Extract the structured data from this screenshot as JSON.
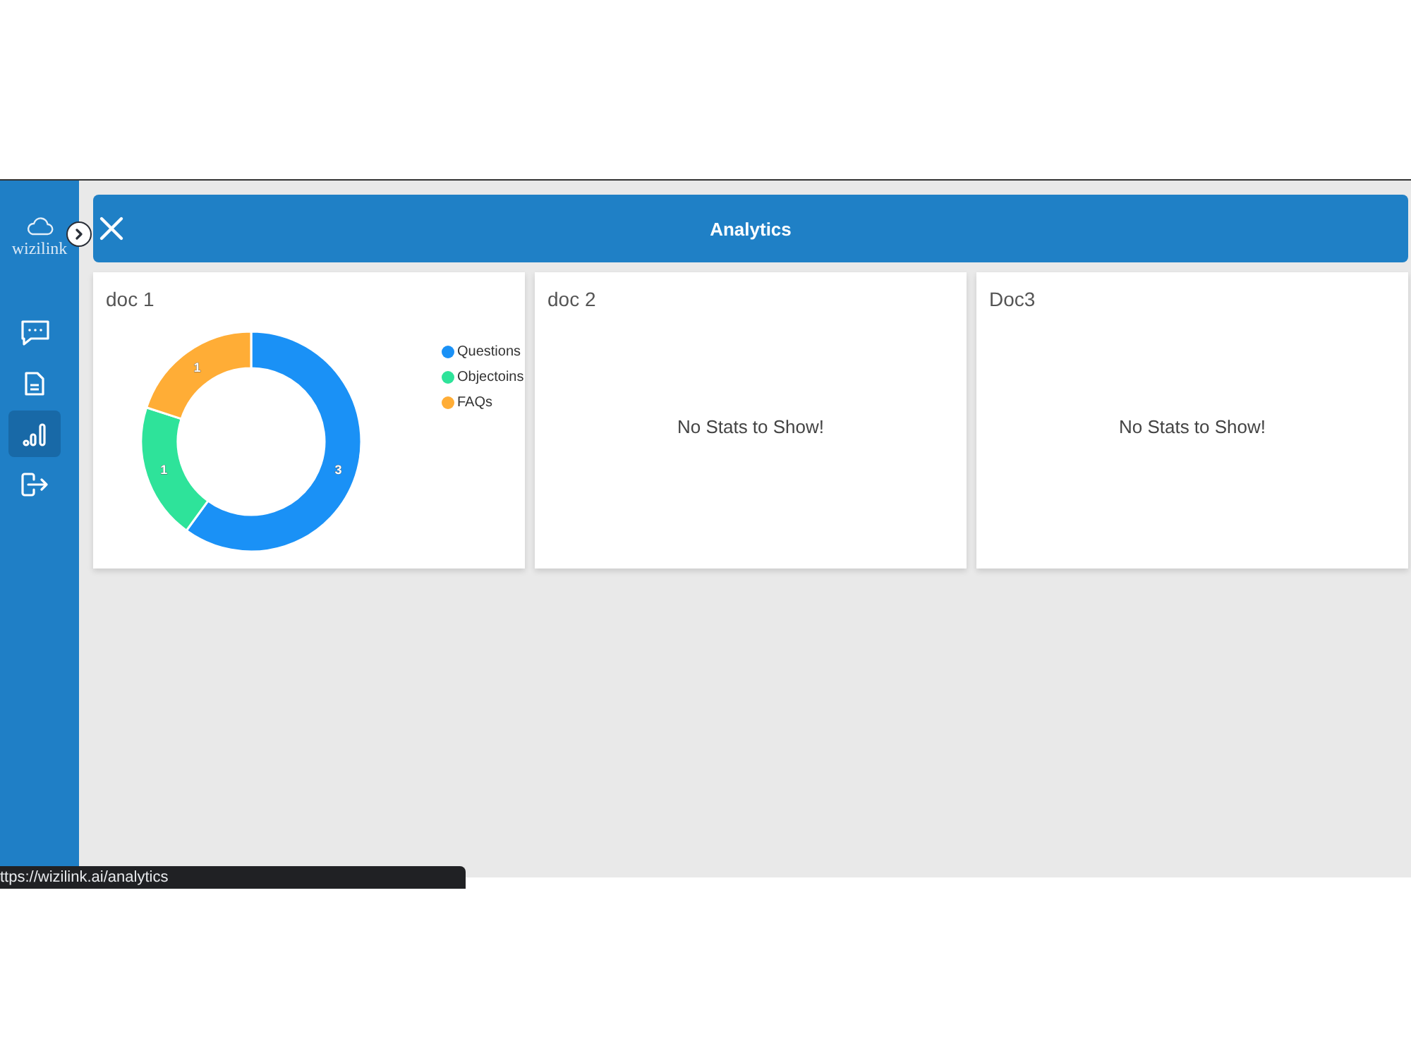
{
  "sidebar": {
    "logo": "wizilink",
    "nav": [
      {
        "kind": "chat",
        "selected": false
      },
      {
        "kind": "document",
        "selected": false
      },
      {
        "kind": "chart",
        "selected": true
      },
      {
        "kind": "logout",
        "selected": false
      }
    ]
  },
  "header": {
    "title": "Analytics"
  },
  "cards": [
    {
      "title": "doc 1",
      "chart_data": {
        "type": "donut",
        "categories": [
          "Questions",
          "Objectoins",
          "FAQs"
        ],
        "series": [
          {
            "values": [
              3,
              1,
              1
            ]
          }
        ],
        "colors": [
          "#1a91f6",
          "#2ee39a",
          "#ffad36"
        ],
        "data_labels": true
      }
    },
    {
      "title": "doc 2",
      "message": "No Stats to Show!"
    },
    {
      "title": "Doc3",
      "message": "No Stats to Show!"
    }
  ],
  "status_bar": {
    "url": "ttps://wizilink.ai/analytics"
  }
}
